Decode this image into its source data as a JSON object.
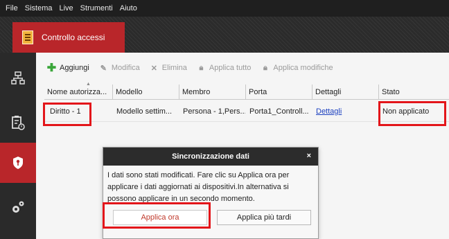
{
  "menubar": {
    "items": [
      "File",
      "Sistema",
      "Live",
      "Strumenti",
      "Aiuto"
    ]
  },
  "tab": {
    "label": "Controllo accessi",
    "icon": "document-icon"
  },
  "sidebar": {
    "items": [
      {
        "name": "device-tree-icon",
        "active": false
      },
      {
        "name": "log-icon",
        "active": false
      },
      {
        "name": "access-shield-icon",
        "active": true
      },
      {
        "name": "settings-gears-icon",
        "active": false
      }
    ]
  },
  "toolbar": {
    "add": "Aggiungi",
    "edit": "Modifica",
    "delete": "Elimina",
    "apply_all": "Applica tutto",
    "apply_changes": "Applica modifiche"
  },
  "table": {
    "columns": [
      "Nome autorizza...",
      "Modello",
      "Membro",
      "Porta",
      "Dettagli",
      "Stato"
    ],
    "rows": [
      {
        "name": "Diritto - 1",
        "model": "Modello settim...",
        "member": "Persona - 1,Pers...",
        "door": "Porta1_Controll...",
        "details": "Dettagli",
        "status": "Non applicato"
      }
    ]
  },
  "dialog": {
    "title": "Sincronizzazione dati",
    "close": "×",
    "message": "I dati sono stati modificati. Fare clic su Applica ora per applicare i dati aggiornati ai dispositivi.In alternativa si possono applicare in un secondo momento.",
    "apply_now": "Applica ora",
    "apply_later": "Applica più tardi"
  },
  "colors": {
    "accent": "#b9262a",
    "highlight": "#e3151a",
    "link": "#1a3fbf"
  }
}
